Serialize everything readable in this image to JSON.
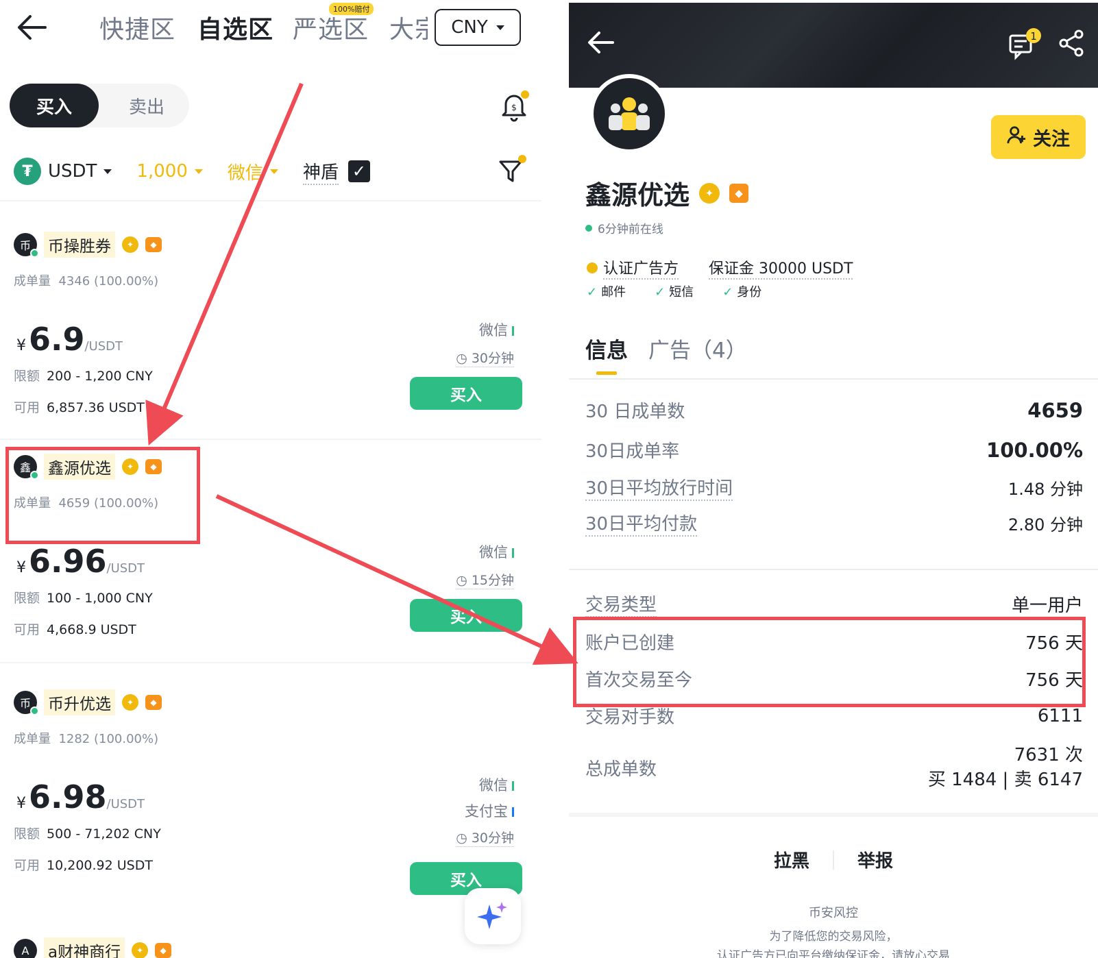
{
  "left": {
    "tabs": {
      "quick": "快捷区",
      "favorites": "自选区",
      "strict": "严选区",
      "big": "大宗",
      "strict_badge": "100%赔付"
    },
    "currency_select": "CNY",
    "buy_label": "买入",
    "sell_label": "卖出",
    "filters": {
      "asset": "USDT",
      "amount": "1,000",
      "payment": "微信",
      "shield": "神盾"
    },
    "listings": [
      {
        "merchant": "币操胜券",
        "deals_label": "成单量",
        "deals": "4346 (100.00%)",
        "yen": "¥",
        "price": "6.9",
        "unit": "/USDT",
        "limit_label": "限额",
        "limit": "200 - 1,200 CNY",
        "avail_label": "可用",
        "available": "6,857.36 USDT",
        "pay_methods": [
          "微信"
        ],
        "time": "30分钟",
        "buy": "买入"
      },
      {
        "merchant": "鑫源优选",
        "deals_label": "成单量",
        "deals": "4659 (100.00%)",
        "yen": "¥",
        "price": "6.96",
        "unit": "/USDT",
        "limit_label": "限额",
        "limit": "100 - 1,000 CNY",
        "avail_label": "可用",
        "available": "4,668.9 USDT",
        "pay_methods": [
          "微信"
        ],
        "time": "15分钟",
        "buy": "买入"
      },
      {
        "merchant": "币升优选",
        "deals_label": "成单量",
        "deals": "1282 (100.00%)",
        "yen": "¥",
        "price": "6.98",
        "unit": "/USDT",
        "limit_label": "限额",
        "limit": "500 - 71,202 CNY",
        "avail_label": "可用",
        "available": "10,200.92 USDT",
        "pay_methods": [
          "微信",
          "支付宝"
        ],
        "time": "30分钟",
        "buy": "买入"
      },
      {
        "merchant": "a财神商行"
      }
    ]
  },
  "right": {
    "chat_badge": "1",
    "follow": "关注",
    "name": "鑫源优选",
    "online": "6分钟前在线",
    "verified": "认证广告方",
    "deposit": "保证金 30000 USDT",
    "checks": [
      "邮件",
      "短信",
      "身份"
    ],
    "tabs": [
      "信息",
      "广告（4）"
    ],
    "stats": [
      {
        "label": "30 日成单数",
        "value": "4659"
      },
      {
        "label": "30日成单率",
        "value": "100.00%"
      },
      {
        "label": "30日平均放行时间",
        "value": "1.48 分钟"
      },
      {
        "label": "30日平均付款",
        "value": "2.80 分钟"
      }
    ],
    "trade_type_label": "交易类型",
    "trade_type": "单一用户",
    "account_created_label": "账户已创建",
    "account_created": "756 天",
    "first_trade_label": "首次交易至今",
    "first_trade": "756 天",
    "counterparties_label": "交易对手数",
    "counterparties": "6111",
    "total_orders_label": "总成单数",
    "total_orders": "7631 次",
    "total_breakdown": "买 1484 | 卖 6147",
    "block": "拉黑",
    "report": "举报",
    "risk_title": "币安风控",
    "risk_line1": "为了降低您的交易风险，",
    "risk_line2": "认证广告方已向平台缴纳保证金，请放心交易"
  }
}
